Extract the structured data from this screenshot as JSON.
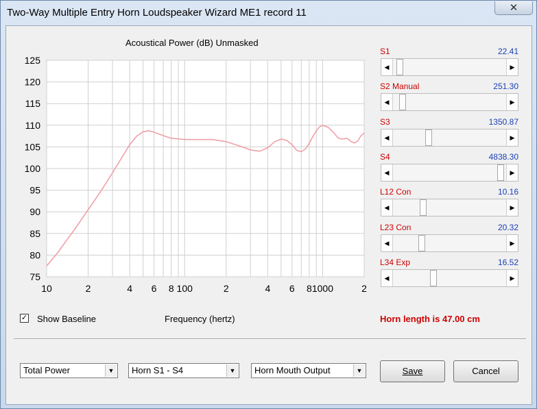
{
  "window": {
    "title": "Two-Way Multiple Entry Horn Loudspeaker Wizard   ME1 record 11",
    "close_glyph": "✕"
  },
  "chart_title": "Acoustical Power (dB)   Unmasked",
  "chart_data": {
    "type": "line",
    "title": "Acoustical Power (dB)   Unmasked",
    "xlabel": "Frequency (hertz)",
    "ylabel": "",
    "xscale": "log",
    "xlim": [
      10,
      2000
    ],
    "ylim": [
      75,
      125
    ],
    "grid": true,
    "y_ticks": [
      75,
      80,
      85,
      90,
      95,
      100,
      105,
      110,
      115,
      120,
      125
    ],
    "x_ticks": [
      {
        "value": 10,
        "label": "10"
      },
      {
        "value": 20,
        "label": "2"
      },
      {
        "value": 40,
        "label": "4"
      },
      {
        "value": 60,
        "label": "6"
      },
      {
        "value": 80,
        "label": "8"
      },
      {
        "value": 100,
        "label": "100"
      },
      {
        "value": 200,
        "label": "2"
      },
      {
        "value": 400,
        "label": "4"
      },
      {
        "value": 600,
        "label": "6"
      },
      {
        "value": 800,
        "label": "8"
      },
      {
        "value": 1000,
        "label": "1000"
      },
      {
        "value": 2000,
        "label": "2"
      }
    ],
    "series_color": "#f0a0a8",
    "series": [
      {
        "x": [
          10,
          12,
          14,
          16,
          20,
          25,
          30,
          35,
          40,
          45,
          50,
          55,
          60,
          70,
          80,
          100,
          130,
          160,
          200,
          250,
          300,
          350,
          400,
          450,
          500,
          550,
          600,
          650,
          700,
          750,
          800,
          850,
          900,
          950,
          1000,
          1100,
          1200,
          1300,
          1400,
          1500,
          1600,
          1700,
          1800,
          1900,
          2000
        ],
        "y": [
          77.5,
          80.5,
          83.5,
          86,
          90.5,
          95,
          99,
          102.5,
          105.5,
          107.5,
          108.5,
          108.7,
          108.4,
          107.6,
          107,
          106.7,
          106.7,
          106.7,
          106.2,
          105.2,
          104.3,
          104.0,
          104.8,
          106.2,
          106.8,
          106.5,
          105.5,
          104.2,
          103.9,
          104.5,
          105.8,
          107.4,
          108.7,
          109.6,
          110.0,
          109.5,
          108.3,
          107.0,
          106.8,
          107.0,
          106.3,
          105.9,
          106.4,
          107.6,
          108.2
        ]
      }
    ]
  },
  "x_axis_label": "Frequency (hertz)",
  "show_baseline": {
    "label": "Show Baseline",
    "checked": true,
    "check_glyph": "✓"
  },
  "sliders": [
    {
      "label": "S1",
      "value": "22.41",
      "position": 0.03
    },
    {
      "label": "S2  Manual",
      "value": "251.30",
      "position": 0.06
    },
    {
      "label": "S3",
      "value": "1350.87",
      "position": 0.3
    },
    {
      "label": "S4",
      "value": "4838.30",
      "position": 0.98
    },
    {
      "label": "L12  Con",
      "value": "10.16",
      "position": 0.25
    },
    {
      "label": "L23  Con",
      "value": "20.32",
      "position": 0.24
    },
    {
      "label": "L34  Exp",
      "value": "16.52",
      "position": 0.35
    }
  ],
  "arrow_left_glyph": "◀",
  "arrow_right_glyph": "▶",
  "horn_length": "Horn length is 47.00 cm",
  "combos": [
    {
      "value": "Total Power"
    },
    {
      "value": "Horn S1 - S4"
    },
    {
      "value": "Horn Mouth Output"
    }
  ],
  "combo_drop_glyph": "▼",
  "buttons": {
    "save": "Save",
    "cancel": "Cancel"
  },
  "colors": {
    "label_red": "#cc0000",
    "value_blue": "#1a3fb5",
    "curve": "#f0a0a8"
  }
}
